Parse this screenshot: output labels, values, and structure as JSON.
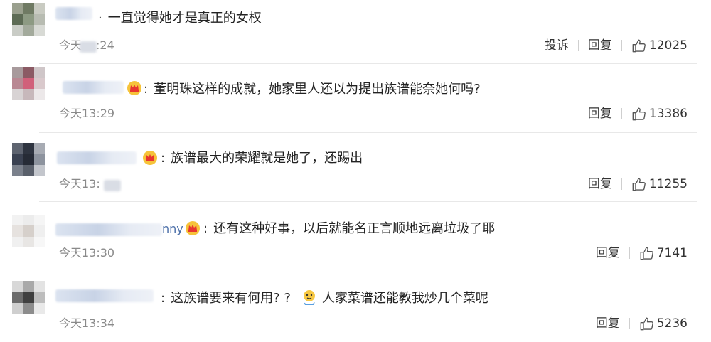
{
  "comments": [
    {
      "text": "一直觉得她才是真正的女权",
      "time_visible": "今天",
      "time_tail": ":24",
      "actions": {
        "report": "投诉",
        "reply": "回复"
      },
      "likes": "12025"
    },
    {
      "text": "董明珠这样的成就，她家里人还以为提出族谱能奈她何吗?",
      "time": "今天13:29",
      "actions": {
        "reply": "回复"
      },
      "likes": "13386",
      "badge_icon": "crown-icon"
    },
    {
      "text": "族谱最大的荣耀就是她了，还踢出",
      "time_visible": "今天13:",
      "actions": {
        "reply": "回复"
      },
      "likes": "11255",
      "badge_icon": "crown-icon"
    },
    {
      "name_tail": "nny",
      "text": "还有这种好事，以后就能名正言顺地远离垃圾了耶",
      "time": "今天13:30",
      "actions": {
        "reply": "回复"
      },
      "likes": "7141",
      "badge_icon": "crown-icon"
    },
    {
      "text_a": "这族谱要来有何用? ?",
      "text_b": "人家菜谱还能教我炒几个菜呢",
      "time": "今天13:34",
      "actions": {
        "reply": "回复"
      },
      "likes": "5236",
      "emoji_icon": "thinking-face-icon"
    }
  ],
  "colors": {
    "text": "#222222",
    "muted": "#8a8a8a",
    "divider": "#e8e8e8",
    "crown": "#e8a623",
    "heart": "#e23b3b"
  }
}
